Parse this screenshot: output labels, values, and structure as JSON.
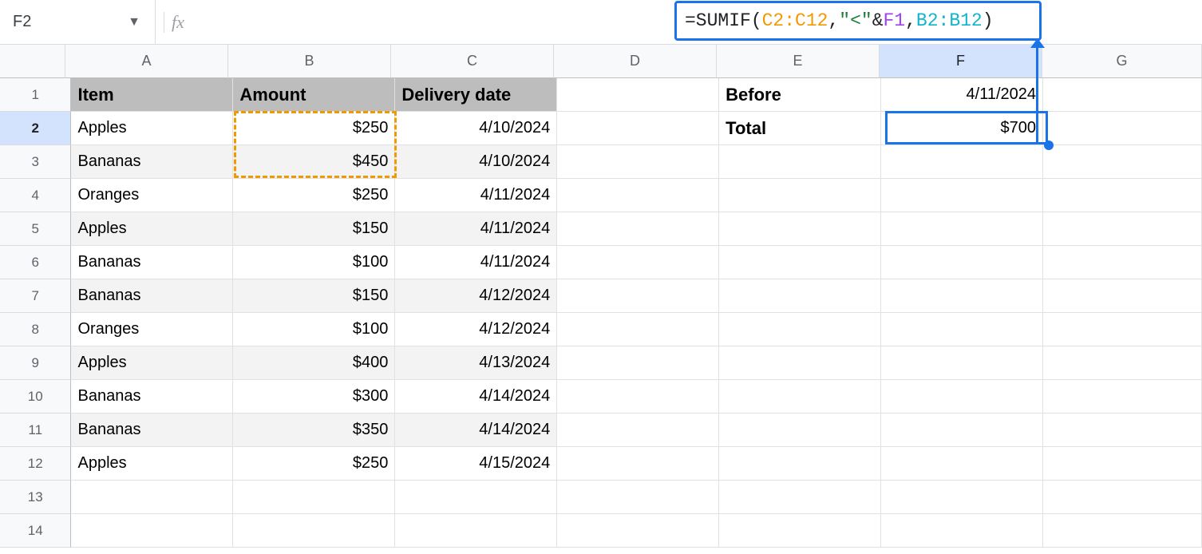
{
  "name_box": "F2",
  "formula": {
    "raw": "=SUMIF(C2:C12, \"<\"&F1, B2:B12)",
    "parts": [
      {
        "t": "=SUMIF(",
        "c": "f-black"
      },
      {
        "t": "C2:C12",
        "c": "f-orange"
      },
      {
        "t": ", ",
        "c": "f-black"
      },
      {
        "t": "\"<\"",
        "c": "f-green"
      },
      {
        "t": "&",
        "c": "f-black"
      },
      {
        "t": "F1",
        "c": "f-purple"
      },
      {
        "t": ", ",
        "c": "f-black"
      },
      {
        "t": "B2:B12",
        "c": "f-teal"
      },
      {
        "t": ")",
        "c": "f-black"
      }
    ]
  },
  "columns": [
    "A",
    "B",
    "C",
    "D",
    "E",
    "F",
    "G"
  ],
  "highlighted_column": "F",
  "highlighted_row": 2,
  "headers": {
    "item": "Item",
    "amount": "Amount",
    "date": "Delivery date"
  },
  "data_rows": [
    {
      "item": "Apples",
      "amount": "$250",
      "date": "4/10/2024",
      "band": false
    },
    {
      "item": "Bananas",
      "amount": "$450",
      "date": "4/10/2024",
      "band": true
    },
    {
      "item": "Oranges",
      "amount": "$250",
      "date": "4/11/2024",
      "band": false
    },
    {
      "item": "Apples",
      "amount": "$150",
      "date": "4/11/2024",
      "band": true
    },
    {
      "item": "Bananas",
      "amount": "$100",
      "date": "4/11/2024",
      "band": false
    },
    {
      "item": "Bananas",
      "amount": "$150",
      "date": "4/12/2024",
      "band": true
    },
    {
      "item": "Oranges",
      "amount": "$100",
      "date": "4/12/2024",
      "band": false
    },
    {
      "item": "Apples",
      "amount": "$400",
      "date": "4/13/2024",
      "band": true
    },
    {
      "item": "Bananas",
      "amount": "$300",
      "date": "4/14/2024",
      "band": false
    },
    {
      "item": "Bananas",
      "amount": "$350",
      "date": "4/14/2024",
      "band": true
    },
    {
      "item": "Apples",
      "amount": "$250",
      "date": "4/15/2024",
      "band": false
    }
  ],
  "side": {
    "before_label": "Before",
    "before_value": "4/11/2024",
    "total_label": "Total",
    "total_value": "$700"
  },
  "row_count": 14,
  "colors": {
    "select_blue": "#1a73e8",
    "dash_orange": "#f29900",
    "header_gray": "#bdbdbd",
    "band_gray": "#f3f3f3"
  }
}
